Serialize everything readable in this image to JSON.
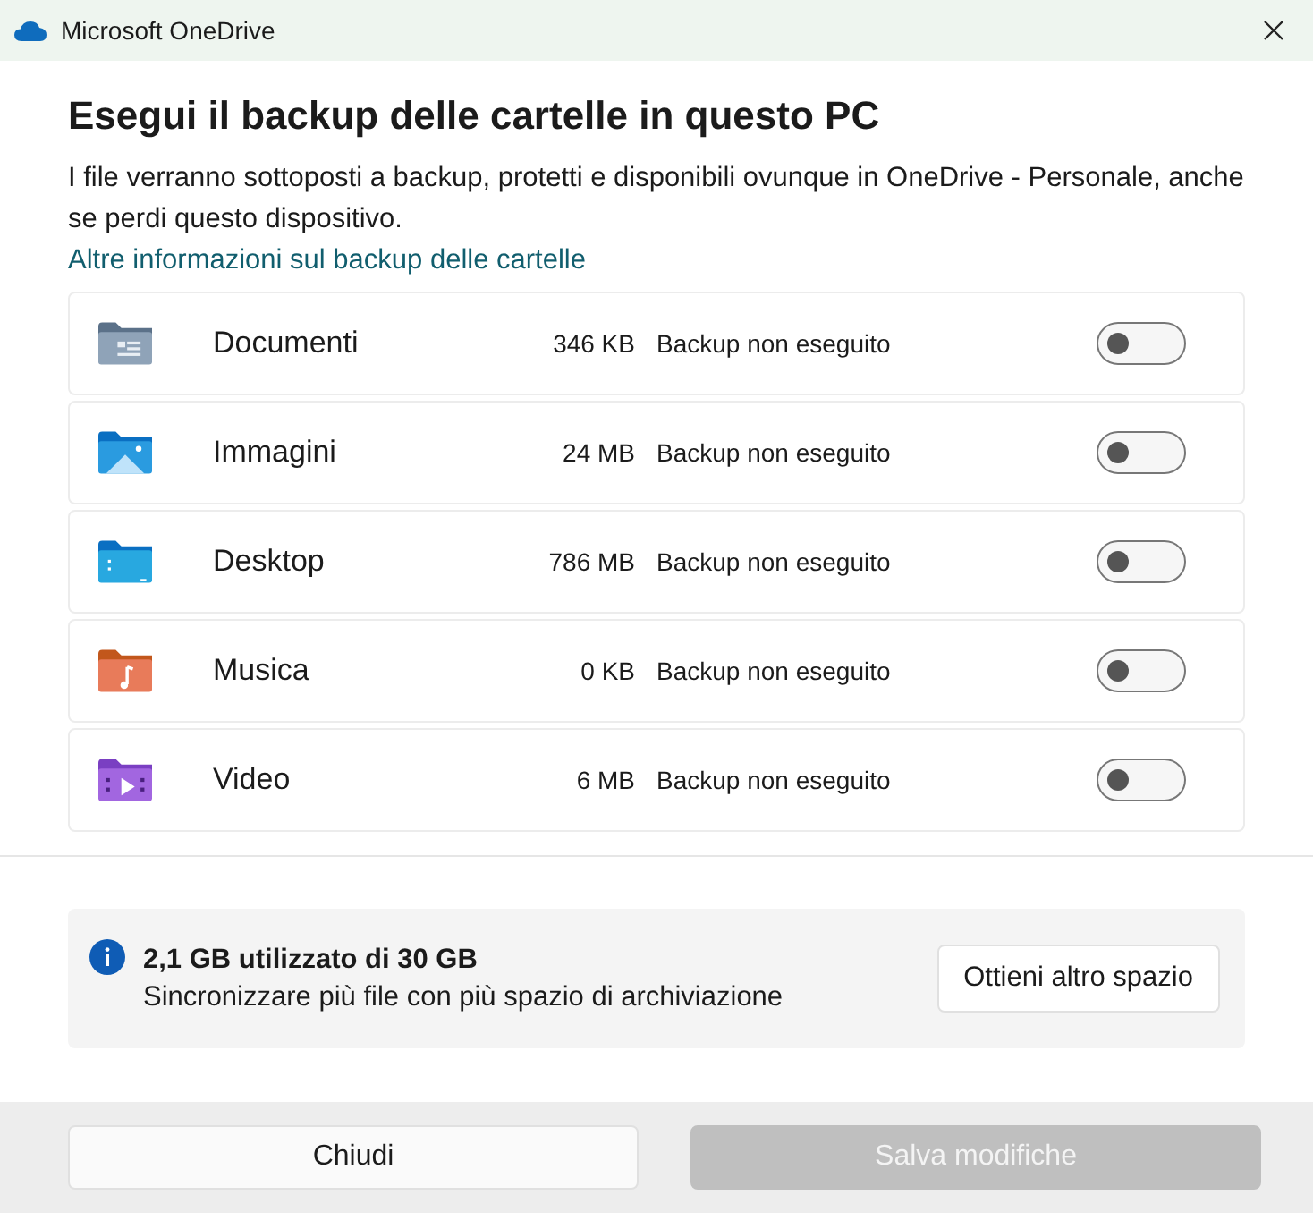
{
  "window": {
    "title": "Microsoft OneDrive"
  },
  "heading": "Esegui il backup delle cartelle in questo PC",
  "description": "I file verranno sottoposti a backup, protetti e disponibili ovunque in OneDrive - Personale, anche se perdi questo dispositivo.",
  "link": "Altre informazioni sul backup delle cartelle",
  "folders": [
    {
      "kind": "documents",
      "name": "Documenti",
      "size": "346 KB",
      "status": "Backup non eseguito",
      "on": false
    },
    {
      "kind": "pictures",
      "name": "Immagini",
      "size": "24 MB",
      "status": "Backup non eseguito",
      "on": false
    },
    {
      "kind": "desktop",
      "name": "Desktop",
      "size": "786 MB",
      "status": "Backup non eseguito",
      "on": false
    },
    {
      "kind": "music",
      "name": "Musica",
      "size": "0 KB",
      "status": "Backup non eseguito",
      "on": false
    },
    {
      "kind": "videos",
      "name": "Video",
      "size": "6 MB",
      "status": "Backup non eseguito",
      "on": false
    }
  ],
  "storage": {
    "usage": "2,1 GB utilizzato di 30 GB",
    "message": "Sincronizzare più file con più spazio di archiviazione",
    "button": "Ottieni altro spazio"
  },
  "buttons": [
    {
      "label": "Chiudi",
      "disabled": false
    },
    {
      "label": "Salva modifiche",
      "disabled": true
    }
  ]
}
